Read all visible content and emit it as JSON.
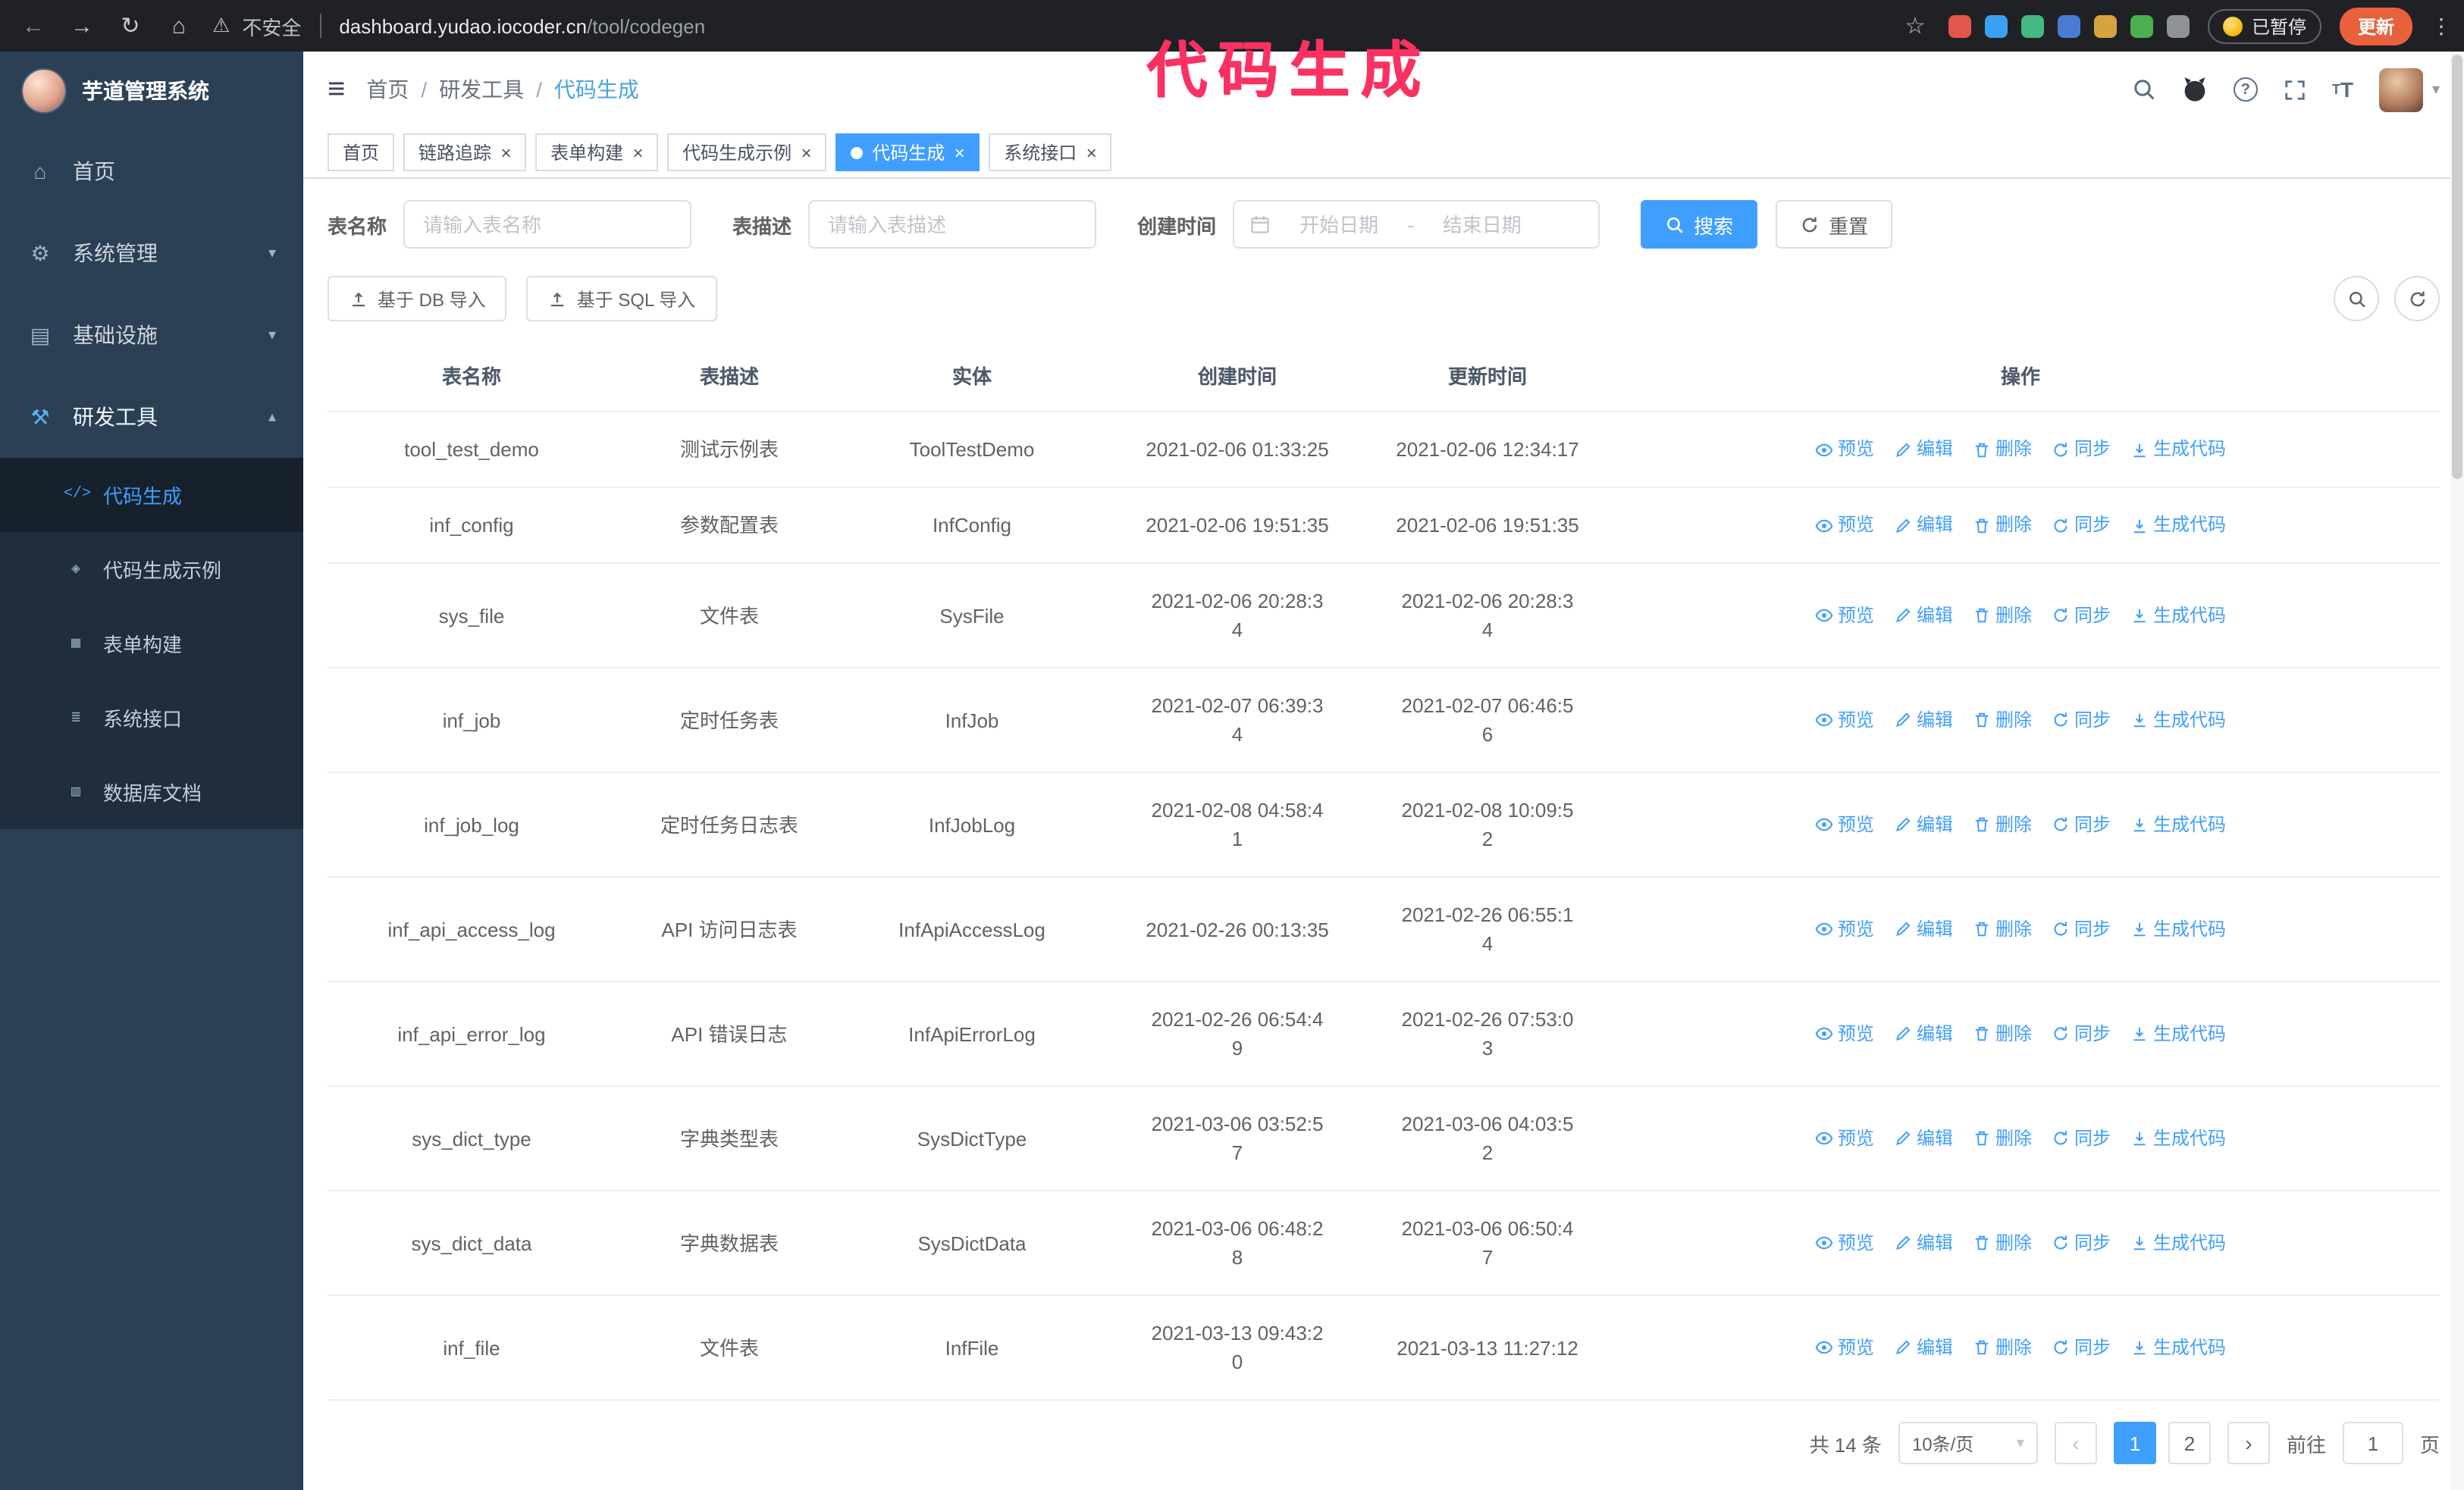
{
  "chrome": {
    "security_label": "不安全",
    "url_domain": "dashboard.yudao.iocoder.cn",
    "url_path": "/tool/codegen",
    "extensions": [
      {
        "name": "extension-1",
        "color": "#e2574c"
      },
      {
        "name": "extension-2",
        "color": "#3aa0f3"
      },
      {
        "name": "extension-3",
        "color": "#42b983"
      },
      {
        "name": "extension-4",
        "color": "#4a7bd4"
      },
      {
        "name": "extension-5",
        "color": "#d5a43c"
      },
      {
        "name": "extension-6",
        "color": "#4caf50"
      },
      {
        "name": "extension-7",
        "color": "#8e9196"
      }
    ],
    "paused_badge": "已暂停",
    "update_button": "更新"
  },
  "annotation": {
    "text": "代码生成",
    "color": "#fa3162"
  },
  "sidebar": {
    "logo_title": "芋道管理系统",
    "items": [
      {
        "label": "首页",
        "icon": "home-icon",
        "icon_char": "⌂",
        "arrow": ""
      },
      {
        "label": "系统管理",
        "icon": "gear-icon",
        "icon_char": "⚙",
        "arrow": "▾"
      },
      {
        "label": "基础设施",
        "icon": "infrastructure-icon",
        "icon_char": "▤",
        "arrow": "▾"
      },
      {
        "label": "研发工具",
        "icon": "dev-tools-icon",
        "icon_char": "⚒",
        "arrow": "▴",
        "expanded": true
      }
    ],
    "subitems": [
      {
        "label": "代码生成",
        "icon": "code-icon",
        "icon_char": "</>",
        "active": true
      },
      {
        "label": "代码生成示例",
        "icon": "example-icon",
        "icon_char": "◈"
      },
      {
        "label": "表单构建",
        "icon": "form-builder-icon",
        "icon_char": "▦"
      },
      {
        "label": "系统接口",
        "icon": "api-icon",
        "icon_char": "≣"
      },
      {
        "label": "数据库文档",
        "icon": "db-doc-icon",
        "icon_char": "▥"
      }
    ]
  },
  "navbar": {
    "breadcrumb": [
      "首页",
      "研发工具",
      "代码生成"
    ],
    "separator": "/"
  },
  "tabs": [
    {
      "label": "首页",
      "closable": false,
      "active": false
    },
    {
      "label": "链路追踪",
      "closable": true,
      "active": false
    },
    {
      "label": "表单构建",
      "closable": true,
      "active": false
    },
    {
      "label": "代码生成示例",
      "closable": true,
      "active": false
    },
    {
      "label": "代码生成",
      "closable": true,
      "active": true
    },
    {
      "label": "系统接口",
      "closable": true,
      "active": false
    }
  ],
  "search": {
    "name_label": "表名称",
    "name_placeholder": "请输入表名称",
    "desc_label": "表描述",
    "desc_placeholder": "请输入表描述",
    "time_label": "创建时间",
    "start_placeholder": "开始日期",
    "range_separator": "-",
    "end_placeholder": "结束日期",
    "search_button": "搜索",
    "reset_button": "重置"
  },
  "toolbar": {
    "import_db_button": "基于 DB 导入",
    "import_sql_button": "基于 SQL 导入"
  },
  "table": {
    "columns": [
      "表名称",
      "表描述",
      "实体",
      "创建时间",
      "更新时间",
      "操作"
    ],
    "op_labels": [
      "预览",
      "编辑",
      "删除",
      "同步",
      "生成代码"
    ],
    "rows": [
      {
        "name": "tool_test_demo",
        "desc": "测试示例表",
        "entity": "ToolTestDemo",
        "create_time": "2021-02-06 01:33:25",
        "update_time": "2021-02-06 12:34:17"
      },
      {
        "name": "inf_config",
        "desc": "参数配置表",
        "entity": "InfConfig",
        "create_time": "2021-02-06 19:51:35",
        "update_time": "2021-02-06 19:51:35"
      },
      {
        "name": "sys_file",
        "desc": "文件表",
        "entity": "SysFile",
        "create_time": "2021-02-06 20:28:3\n4",
        "update_time": "2021-02-06 20:28:3\n4"
      },
      {
        "name": "inf_job",
        "desc": "定时任务表",
        "entity": "InfJob",
        "create_time": "2021-02-07 06:39:3\n4",
        "update_time": "2021-02-07 06:46:5\n6"
      },
      {
        "name": "inf_job_log",
        "desc": "定时任务日志表",
        "entity": "InfJobLog",
        "create_time": "2021-02-08 04:58:4\n1",
        "update_time": "2021-02-08 10:09:5\n2"
      },
      {
        "name": "inf_api_access_log",
        "desc": "API 访问日志表",
        "entity": "InfApiAccessLog",
        "create_time": "2021-02-26 00:13:35",
        "update_time": "2021-02-26 06:55:1\n4"
      },
      {
        "name": "inf_api_error_log",
        "desc": "API 错误日志",
        "entity": "InfApiErrorLog",
        "create_time": "2021-02-26 06:54:4\n9",
        "update_time": "2021-02-26 07:53:0\n3"
      },
      {
        "name": "sys_dict_type",
        "desc": "字典类型表",
        "entity": "SysDictType",
        "create_time": "2021-03-06 03:52:5\n7",
        "update_time": "2021-03-06 04:03:5\n2"
      },
      {
        "name": "sys_dict_data",
        "desc": "字典数据表",
        "entity": "SysDictData",
        "create_time": "2021-03-06 06:48:2\n8",
        "update_time": "2021-03-06 06:50:4\n7"
      },
      {
        "name": "inf_file",
        "desc": "文件表",
        "entity": "InfFile",
        "create_time": "2021-03-13 09:43:2\n0",
        "update_time": "2021-03-13 11:27:12"
      }
    ]
  },
  "pagination": {
    "total_text": "共 14 条",
    "page_size": "10条/页",
    "pages": [
      {
        "label": "1",
        "active": true
      },
      {
        "label": "2",
        "active": false
      }
    ],
    "goto_label": "前往",
    "goto_value": "1",
    "goto_suffix": "页"
  },
  "icons": {
    "back": "←",
    "forward": "→",
    "reload": "↻",
    "home": "⌂",
    "warning": "⚠",
    "star": "☆",
    "kebab": "⋮",
    "hamburger": "≡",
    "caret_down": "▾",
    "close": "×",
    "prev": "‹",
    "next": "›"
  },
  "colors": {
    "primary": "#409eff",
    "sidebar_bg": "#2b4055",
    "submenu_bg": "#1f2d3d",
    "link": "#409eff",
    "annotation": "#fa3162",
    "update_button_bg": "#e8613c"
  }
}
